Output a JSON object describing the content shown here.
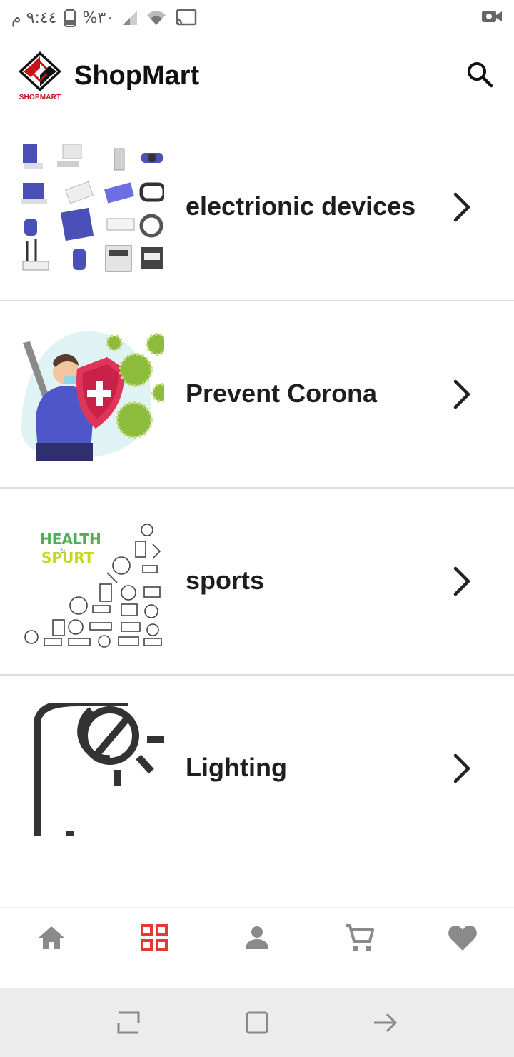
{
  "status_bar": {
    "time": "٩:٤٤ م",
    "battery": "%٣٠"
  },
  "app_bar": {
    "title": "ShopMart",
    "logo_text": "SHOPMART",
    "brand_color": "#c4121a"
  },
  "categories": [
    {
      "label": "electrionic devices",
      "image": "electronic-devices-illustration"
    },
    {
      "label": "Prevent Corona",
      "image": "corona-prevention-illustration"
    },
    {
      "label": "sports",
      "image": "health-sport-illustration",
      "image_text_top": "HEALTH",
      "image_text_mid": "&",
      "image_text_bottom": "SPURT"
    },
    {
      "label": "Lighting",
      "image": "street-lamp-illustration"
    }
  ],
  "bottom_nav": {
    "items": [
      {
        "icon": "home-icon",
        "active": false
      },
      {
        "icon": "grid-icon",
        "active": true
      },
      {
        "icon": "person-icon",
        "active": false
      },
      {
        "icon": "cart-icon",
        "active": false
      },
      {
        "icon": "heart-icon",
        "active": false
      }
    ],
    "active_color": "#e53935",
    "inactive_color": "#8a8a8a"
  }
}
